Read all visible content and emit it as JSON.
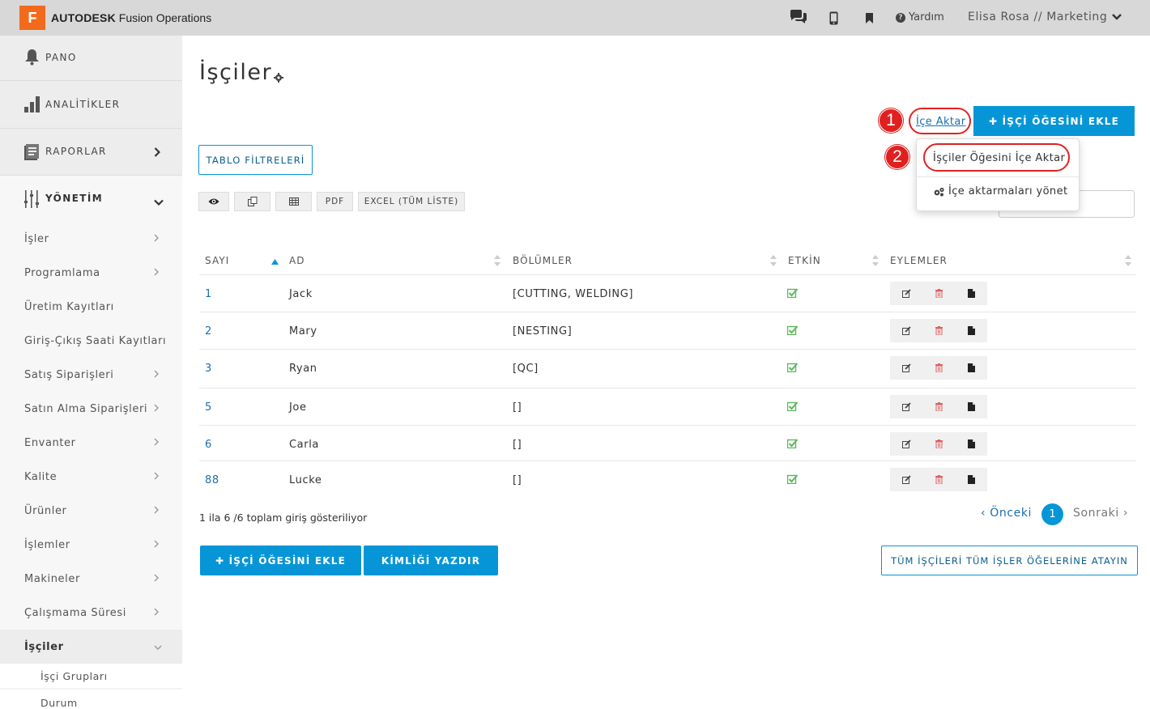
{
  "topbar": {
    "brand_logo_letter": "F",
    "brand_bold": "AUTODESK",
    "brand_rest": " Fusion Operations",
    "icons": [
      "chat-icon",
      "mobile-icon",
      "bookmark-icon"
    ],
    "help_label": "Yardım",
    "user_label": "Elisa Rosa // Marketing"
  },
  "sidebar": {
    "main": [
      {
        "label": "PANO",
        "icon": "bell-icon"
      },
      {
        "label": "ANALİTİKLER",
        "icon": "bar-chart-icon"
      },
      {
        "label": "RAPORLAR",
        "icon": "report-icon"
      },
      {
        "label": "YÖNETİM",
        "icon": "sliders-icon"
      }
    ],
    "items": [
      {
        "label": "İşler"
      },
      {
        "label": "Programlama"
      },
      {
        "label": "Üretim Kayıtları"
      },
      {
        "label": "Giriş-Çıkış Saati Kayıtları"
      },
      {
        "label": "Satış Siparişleri"
      },
      {
        "label": "Satın Alma Siparişleri"
      },
      {
        "label": "Envanter"
      },
      {
        "label": "Kalite"
      },
      {
        "label": "Ürünler"
      },
      {
        "label": "İşlemler"
      },
      {
        "label": "Makineler"
      },
      {
        "label": "Çalışmama Süresi"
      },
      {
        "label": "İşçiler"
      }
    ],
    "subitems": [
      {
        "label": "İşçi Grupları"
      },
      {
        "label": "Durum"
      }
    ]
  },
  "page": {
    "title": "İşçiler",
    "import_link": "İçe Aktar",
    "add_worker_top": "✚ İŞÇİ ÖĞESİNİ EKLE",
    "markers": [
      "1",
      "2"
    ],
    "dropdown": {
      "import_workers": "İşçiler Öğesini İçe Aktar",
      "manage_imports": "İçe aktarmaları yönet"
    },
    "table_filters": "TABLO FİLTRELERİ",
    "toolbar": {
      "pdf": "PDF",
      "excel": "EXCEL (TÜM LİSTE)"
    }
  },
  "table": {
    "headers": [
      "SAYI",
      "AD",
      "BÖLÜMLER",
      "ETKİN",
      "EYLEMLER"
    ],
    "rows": [
      {
        "id": "1",
        "name": "Jack",
        "departments": "[CUTTING, WELDING]",
        "active": true
      },
      {
        "id": "2",
        "name": "Mary",
        "departments": "[NESTING]",
        "active": true
      },
      {
        "id": "3",
        "name": "Ryan",
        "departments": "[QC]",
        "active": true
      },
      {
        "id": "5",
        "name": "Joe",
        "departments": "[]",
        "active": true
      },
      {
        "id": "6",
        "name": "Carla",
        "departments": "[]",
        "active": true
      },
      {
        "id": "88",
        "name": "Lucke",
        "departments": "[]",
        "active": true
      }
    ]
  },
  "footer": {
    "info": "1 ila 6 /6 toplam giriş gösteriliyor",
    "prev": "‹ Önceki",
    "page": "1",
    "next": "Sonraki ›",
    "add_worker": "✚ İŞÇİ ÖĞESİNİ EKLE",
    "print_id": "KİMLİĞİ YAZDIR",
    "assign_all": "TÜM İŞÇİLERİ TÜM İŞLER ÖĞELERİNE ATAYIN"
  },
  "colors": {
    "accent": "#0696d7",
    "brand_orange": "#f26b1d",
    "active_green": "#5cb85c",
    "delete_red": "#e06060",
    "annotation_red": "#e0201f"
  }
}
